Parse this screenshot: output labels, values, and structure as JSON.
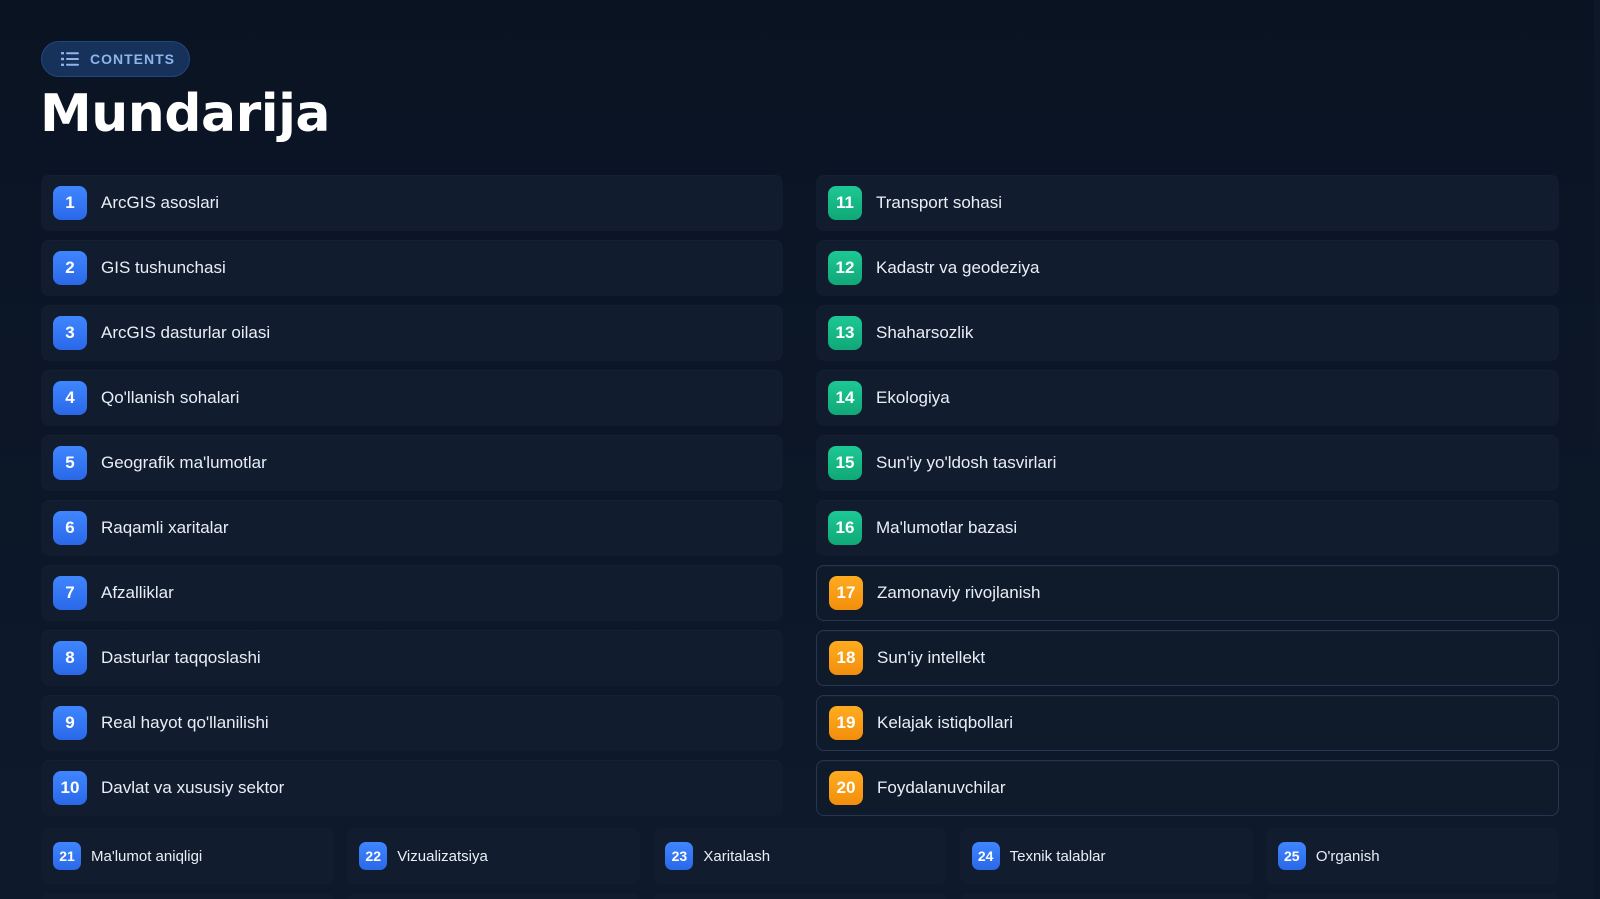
{
  "header": {
    "badge_label": "CONTENTS",
    "badge_icon": "list-icon",
    "title": "Mundarija"
  },
  "colors": {
    "blue": "#3478f6",
    "green": "#14b884",
    "orange": "#f7a01a",
    "background": "#0b1424",
    "row": "#111c2e"
  },
  "left_items": [
    {
      "num": "1",
      "label": "ArcGIS asoslari"
    },
    {
      "num": "2",
      "label": "GIS tushunchasi"
    },
    {
      "num": "3",
      "label": "ArcGIS dasturlar oilasi"
    },
    {
      "num": "4",
      "label": "Qo'llanish sohalari"
    },
    {
      "num": "5",
      "label": "Geografik ma'lumotlar"
    },
    {
      "num": "6",
      "label": "Raqamli xaritalar"
    },
    {
      "num": "7",
      "label": "Afzalliklar"
    },
    {
      "num": "8",
      "label": "Dasturlar taqqoslashi"
    },
    {
      "num": "9",
      "label": "Real hayot qo'llanilishi"
    },
    {
      "num": "10",
      "label": "Davlat va xususiy sektor"
    }
  ],
  "right_items": [
    {
      "num": "11",
      "label": "Transport sohasi",
      "color": "green"
    },
    {
      "num": "12",
      "label": "Kadastr va geodeziya",
      "color": "green"
    },
    {
      "num": "13",
      "label": "Shaharsozlik",
      "color": "green"
    },
    {
      "num": "14",
      "label": "Ekologiya",
      "color": "green"
    },
    {
      "num": "15",
      "label": "Sun'iy yo'ldosh tasvirlari",
      "color": "green"
    },
    {
      "num": "16",
      "label": "Ma'lumotlar bazasi",
      "color": "green"
    },
    {
      "num": "17",
      "label": "Zamonaviy rivojlanish",
      "color": "orange"
    },
    {
      "num": "18",
      "label": "Sun'iy intellekt",
      "color": "orange"
    },
    {
      "num": "19",
      "label": "Kelajak istiqbollari",
      "color": "orange"
    },
    {
      "num": "20",
      "label": "Foydalanuvchilar",
      "color": "orange"
    }
  ],
  "bottom_items": [
    {
      "num": "21",
      "label": "Ma'lumot aniqligi"
    },
    {
      "num": "22",
      "label": "Vizualizatsiya"
    },
    {
      "num": "23",
      "label": "Xaritalash"
    },
    {
      "num": "24",
      "label": "Texnik talablar"
    },
    {
      "num": "25",
      "label": "O'rganish"
    }
  ]
}
